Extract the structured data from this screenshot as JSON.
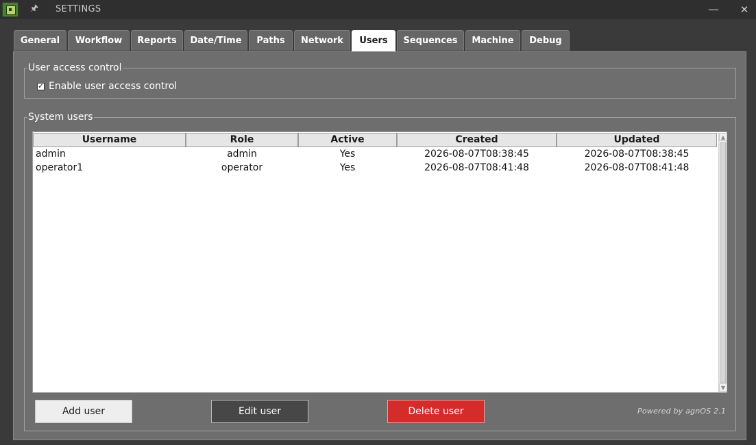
{
  "window": {
    "title": "SETTINGS"
  },
  "tabs": [
    {
      "label": "General"
    },
    {
      "label": "Workflow"
    },
    {
      "label": "Reports"
    },
    {
      "label": "Date/Time"
    },
    {
      "label": "Paths"
    },
    {
      "label": "Network"
    },
    {
      "label": "Users"
    },
    {
      "label": "Sequences"
    },
    {
      "label": "Machine"
    },
    {
      "label": "Debug"
    }
  ],
  "active_tab": "Users",
  "access_control": {
    "group_title": "User access control",
    "checkbox_label": "Enable user access control",
    "checked": true
  },
  "system_users": {
    "group_title": "System users",
    "columns": [
      "Username",
      "Role",
      "Active",
      "Created",
      "Updated"
    ],
    "rows": [
      {
        "username": "admin",
        "role": "admin",
        "active": "Yes",
        "created": "2026-08-07T08:38:45",
        "updated": "2026-08-07T08:38:45"
      },
      {
        "username": "operator1",
        "role": "operator",
        "active": "Yes",
        "created": "2026-08-07T08:41:48",
        "updated": "2026-08-07T08:41:48"
      }
    ]
  },
  "buttons": {
    "add": "Add user",
    "edit": "Edit user",
    "delete": "Delete user"
  },
  "footer": {
    "powered_by": "Powered by agnOS 2.1"
  },
  "colors": {
    "delete_button": "#d42b2b",
    "edit_button": "#474747",
    "active_tab": "#ffffff"
  }
}
